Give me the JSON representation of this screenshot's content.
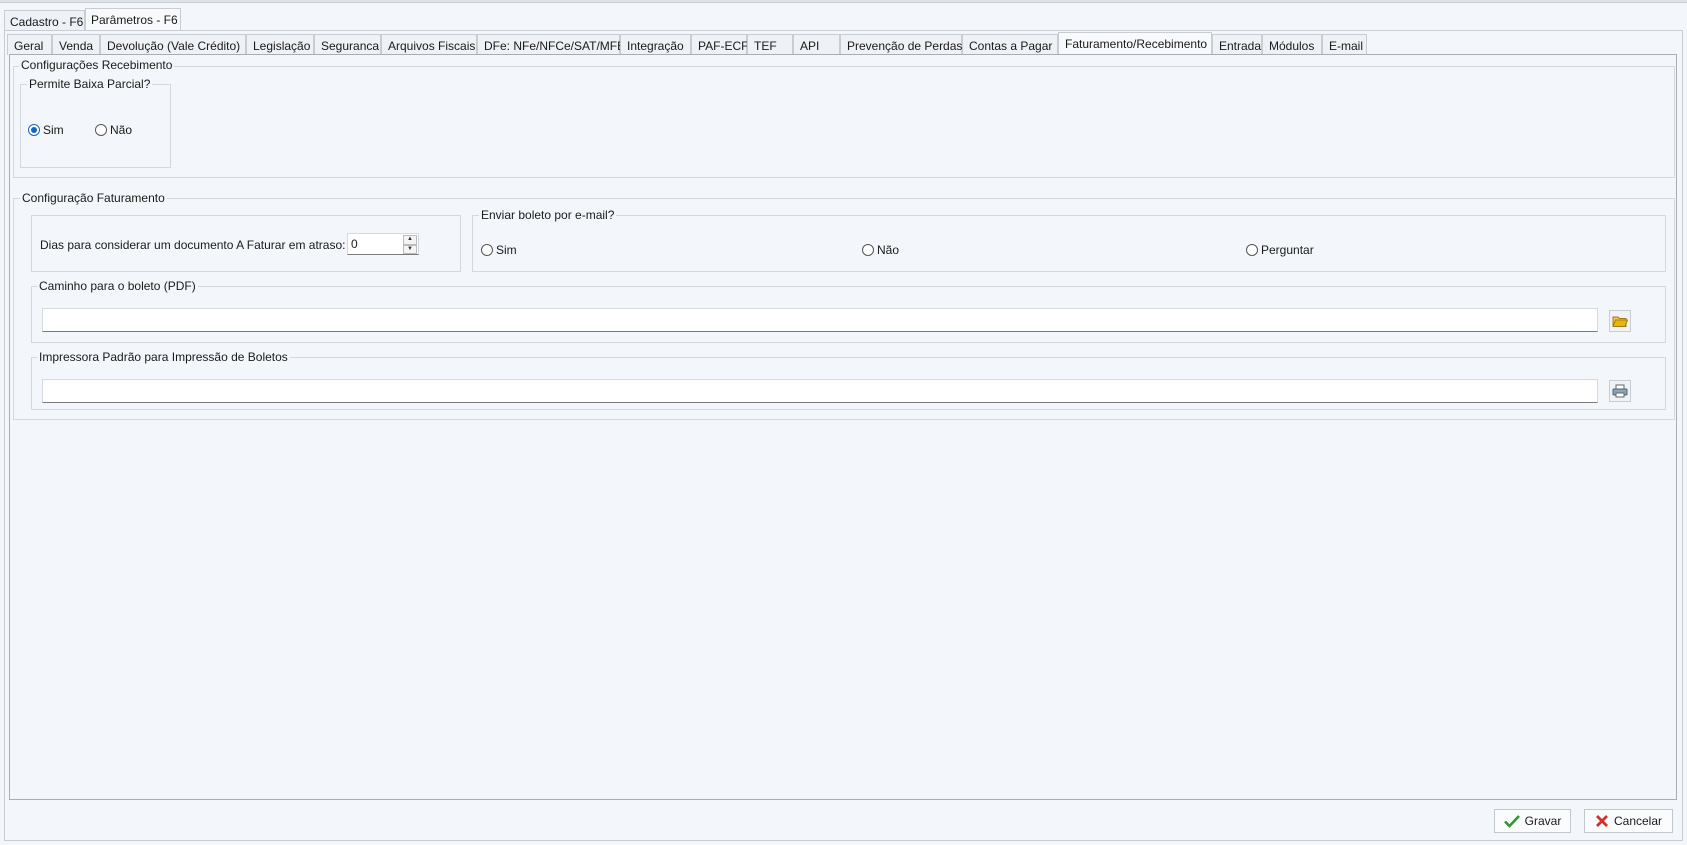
{
  "outer_tabs": [
    {
      "label": "Cadastro - F6"
    },
    {
      "label": "Parâmetros - F6"
    }
  ],
  "inner_tabs": [
    {
      "label": "Geral"
    },
    {
      "label": "Venda"
    },
    {
      "label": "Devolução (Vale Crédito)"
    },
    {
      "label": "Legislação"
    },
    {
      "label": "Seguranca"
    },
    {
      "label": "Arquivos Fiscais"
    },
    {
      "label": "DFe: NFe/NFCe/SAT/MFE"
    },
    {
      "label": "Integração"
    },
    {
      "label": "PAF-ECF"
    },
    {
      "label": "TEF"
    },
    {
      "label": "API"
    },
    {
      "label": "Prevenção de Perdas"
    },
    {
      "label": "Contas a Pagar"
    },
    {
      "label": "Faturamento/Recebimento"
    },
    {
      "label": "Entrada"
    },
    {
      "label": "Módulos"
    },
    {
      "label": "E-mail"
    }
  ],
  "recebimento": {
    "title": "Configurações Recebimento",
    "baixa_parcial": {
      "title": "Permite Baixa Parcial?",
      "options": [
        "Sim",
        "Não"
      ],
      "selected": "Sim"
    }
  },
  "faturamento": {
    "title": "Configuração Faturamento",
    "dias_label": "Dias para considerar um documento A Faturar em atraso:",
    "dias_value": "0",
    "enviar_boleto": {
      "title": "Enviar boleto por e-mail?",
      "options": [
        "Sim",
        "Não",
        "Perguntar"
      ]
    },
    "caminho": {
      "title": "Caminho para o boleto (PDF)",
      "value": ""
    },
    "impressora": {
      "title": "Impressora Padrão para Impressão de Boletos",
      "value": ""
    }
  },
  "footer": {
    "save_label": "Gravar",
    "cancel_label": "Cancelar"
  },
  "colors": {
    "accent": "#1565c0",
    "save_icon": "#2e9a2e",
    "cancel_icon": "#d32f2f",
    "folder_icon": "#e7b416"
  }
}
